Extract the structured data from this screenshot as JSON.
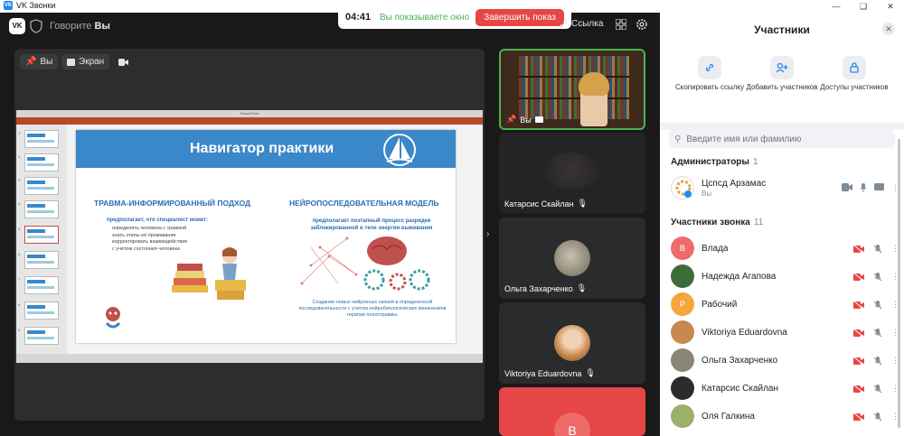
{
  "window": {
    "title": "VK Звонки"
  },
  "topbar": {
    "speaking_prefix": "Говорите",
    "speaking_name": "Вы"
  },
  "share": {
    "timer": "04:41",
    "message": "Вы показываете окно",
    "stop_label": "Завершить показ"
  },
  "toolbar": {
    "link_label": "Ссылка"
  },
  "stage": {
    "pin_label": "Вы",
    "screen_label": "Экран"
  },
  "slide": {
    "title": "Навигатор практики",
    "left_heading": "ТРАВМА-ИНФОРМИРОВАННЫЙ ПОДХОД",
    "right_heading": "НЕЙРОПОСЛЕДОВАТЕЛЬНАЯ МОДЕЛЬ",
    "left_lead": "предполагает, что специалист может:",
    "left_items": [
      "определять человека с травмой",
      "знать этапы её проживания",
      "корректировать взаимодействие",
      "с учётом состояния человека"
    ],
    "right_lead": "предполагает поэтапный процесс разрядки заблокированной в теле энергии выживания",
    "right_note": "Создание новых нейронных связей в определенной последовательности с учетом нейробиологических механизмов терапии психотравмы."
  },
  "tiles": {
    "me": "Вы",
    "katarsis": "Катарсис Скайлан",
    "olga": "Ольга Захарченко",
    "viktoriya": "Viktoriya Eduardovna",
    "v_initial": "В"
  },
  "panel": {
    "title": "Участники",
    "actions": {
      "copy": "Скопировать ссылку",
      "add": "Добавить участников",
      "access": "Доступы участников"
    },
    "search_placeholder": "Введите имя или фамилию",
    "admins_label": "Администраторы",
    "admins_count": "1",
    "admin_name": "Цспсд Арзамас",
    "admin_sub": "Вы",
    "participants_label": "Участники звонка",
    "participants_count": "11",
    "participants": [
      {
        "name": "Влада",
        "initial": "В",
        "color": "#ef6a6a"
      },
      {
        "name": "Надежда Агапова",
        "initial": "",
        "color": "#3e6b3a"
      },
      {
        "name": "Рабочий",
        "initial": "Р",
        "color": "#f4a53b"
      },
      {
        "name": "Viktoriya Eduardovna",
        "initial": "",
        "color": "#c8884e"
      },
      {
        "name": "Ольга Захарченко",
        "initial": "",
        "color": "#8a8575"
      },
      {
        "name": "Катарсис Скайлан",
        "initial": "",
        "color": "#2c2c2c"
      },
      {
        "name": "Оля Галкина",
        "initial": "",
        "color": "#9bb06a"
      }
    ]
  }
}
